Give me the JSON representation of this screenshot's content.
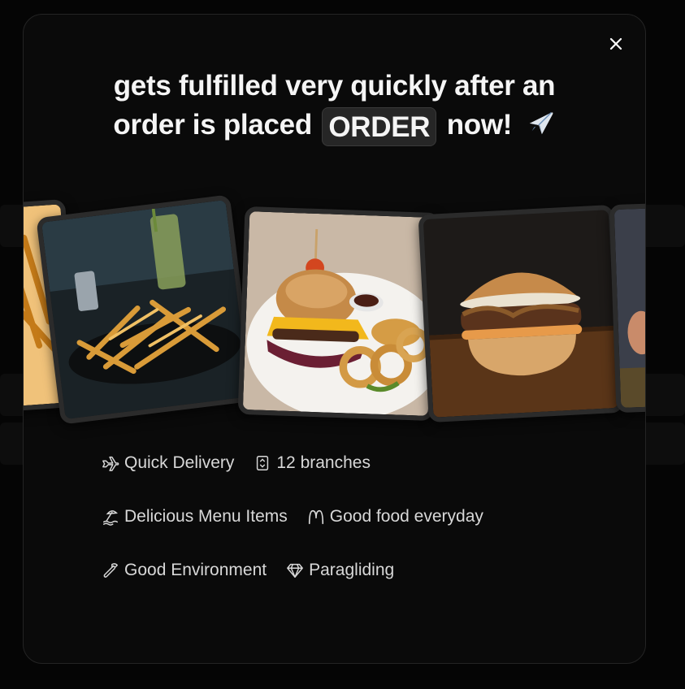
{
  "modal": {
    "headline_line1": "gets fulfilled very quickly after an",
    "headline_line2_pre": "order is placed",
    "headline_highlight": "ORDER",
    "headline_line2_post": "now!",
    "headline_emoji": "airplane-icon"
  },
  "gallery": {
    "images": [
      {
        "subject": "fries-partial"
      },
      {
        "subject": "french-fries"
      },
      {
        "subject": "burger-with-onion-rings"
      },
      {
        "subject": "cheeseburger"
      },
      {
        "subject": "person-partial"
      }
    ]
  },
  "features": {
    "rows": [
      [
        {
          "icon": "plane-icon",
          "label": "Quick Delivery"
        },
        {
          "icon": "elevator-icon",
          "label": "12 branches"
        }
      ],
      [
        {
          "icon": "beach-icon",
          "label": "Delicious Menu Items"
        },
        {
          "icon": "mcdonalds-icon",
          "label": "Good food everyday"
        }
      ],
      [
        {
          "icon": "wrench-icon",
          "label": "Good Environment"
        },
        {
          "icon": "diamond-icon",
          "label": "Paragliding"
        }
      ]
    ]
  },
  "colors": {
    "background": "#050505",
    "modal": "#0a0a0a",
    "text": "#d8d8d8",
    "headline": "#f5f5f5"
  }
}
